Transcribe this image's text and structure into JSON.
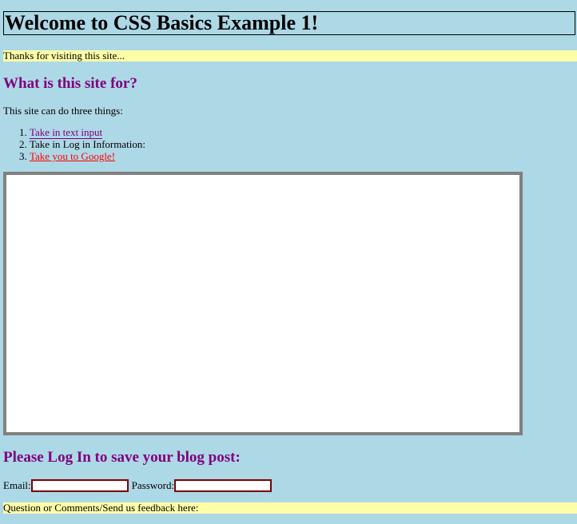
{
  "header": {
    "title": "Welcome to CSS Basics Example 1!"
  },
  "banner_top": "Thanks for visiting this site...",
  "section_about": {
    "heading": "What is this site for?",
    "intro": "This site can do three things:",
    "items": [
      {
        "label": "Take in text input"
      },
      {
        "label": "Take in Log in Information:"
      },
      {
        "label": "Take you to Google!"
      }
    ]
  },
  "login": {
    "heading": "Please Log In to save your blog post:",
    "email_label": "Email:",
    "email_value": "",
    "password_label": "Password:",
    "password_value": ""
  },
  "banner_bottom": "Question or Comments/Send us feedback here:",
  "colors": {
    "background": "#add8e6",
    "banner": "#ffffa8",
    "heading": "#800080",
    "link_red": "#ff0000",
    "frame_border": "#808080",
    "input_border": "#800000"
  }
}
